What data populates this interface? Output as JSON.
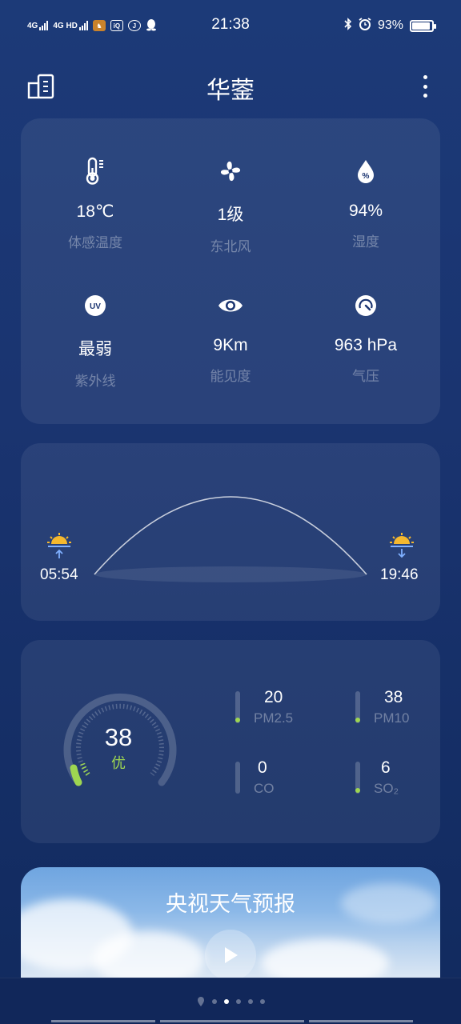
{
  "status_bar": {
    "signal1": "4G",
    "signal2": "4G HD",
    "time": "21:38",
    "battery": "93%",
    "battery_level": 0.93
  },
  "header": {
    "city": "华蓥"
  },
  "details": [
    {
      "icon": "thermometer-icon",
      "value": "18℃",
      "label": "体感温度"
    },
    {
      "icon": "fan-icon",
      "value": "1级",
      "label": "东北风"
    },
    {
      "icon": "humidity-drop-icon",
      "value": "94%",
      "label": "湿度"
    },
    {
      "icon": "uv-icon",
      "value": "最弱",
      "label": "紫外线"
    },
    {
      "icon": "eye-icon",
      "value": "9Km",
      "label": "能见度"
    },
    {
      "icon": "pressure-gauge-icon",
      "value": "963 hPa",
      "label": "气压"
    }
  ],
  "sun": {
    "sunrise": "05:54",
    "sunset": "19:46"
  },
  "aqi": {
    "value": "38",
    "quality": "优",
    "pollutants": [
      {
        "value": "20",
        "name": "PM2.5"
      },
      {
        "value": "38",
        "name": "PM10"
      },
      {
        "value": "0",
        "name": "CO"
      },
      {
        "value": "6",
        "name": "SO₂"
      }
    ]
  },
  "video": {
    "title": "央视天气预报"
  },
  "colors": {
    "accent_green": "#9ed651",
    "sun_yellow": "#f5b82e",
    "background": "#1a3470"
  }
}
